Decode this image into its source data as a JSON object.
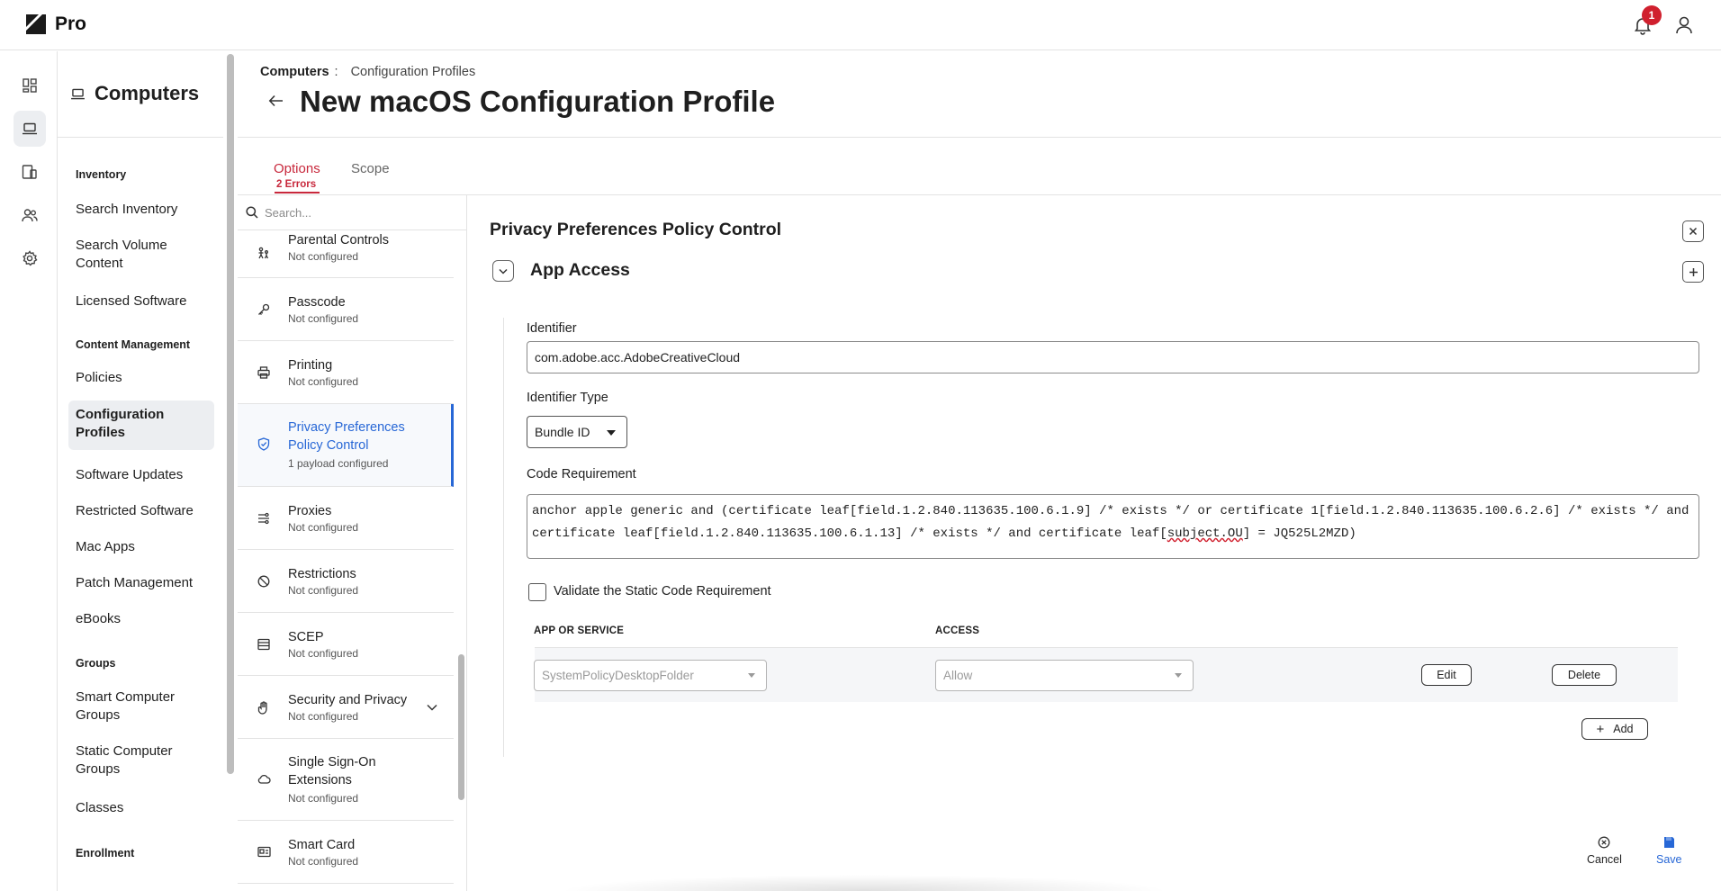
{
  "app": {
    "name": "Pro",
    "notification_count": "1"
  },
  "rail": {
    "items": [
      "dashboard-icon",
      "laptop-icon",
      "devices-icon",
      "users-icon",
      "gear-icon"
    ],
    "active": "laptop-icon"
  },
  "nav": {
    "title": "Computers",
    "sections": [
      {
        "heading": "Inventory",
        "items": [
          "Search Inventory",
          "Search Volume Content",
          "Licensed Software"
        ]
      },
      {
        "heading": "Content Management",
        "items": [
          "Policies",
          "Configuration Profiles",
          "Software Updates",
          "Restricted Software",
          "Mac Apps",
          "Patch Management",
          "eBooks"
        ]
      },
      {
        "heading": "Groups",
        "items": [
          "Smart Computer Groups",
          "Static Computer Groups",
          "Classes"
        ]
      },
      {
        "heading": "Enrollment",
        "items": []
      }
    ],
    "active_item": "Configuration Profiles"
  },
  "breadcrumb": {
    "root": "Computers",
    "separator": ":",
    "current": "Configuration Profiles"
  },
  "page": {
    "title": "New macOS Configuration Profile"
  },
  "tabs": {
    "options": "Options",
    "options_errors": "2 Errors",
    "scope": "Scope"
  },
  "payloads": {
    "search_placeholder": "Search...",
    "items": [
      {
        "name": "Parental Controls",
        "status": "Not configured"
      },
      {
        "name": "Passcode",
        "status": "Not configured"
      },
      {
        "name": "Printing",
        "status": "Not configured"
      },
      {
        "name": "Privacy Preferences Policy Control",
        "status": "1 payload configured"
      },
      {
        "name": "Proxies",
        "status": "Not configured"
      },
      {
        "name": "Restrictions",
        "status": "Not configured"
      },
      {
        "name": "SCEP",
        "status": "Not configured"
      },
      {
        "name": "Security and Privacy",
        "status": "Not configured"
      },
      {
        "name": "Single Sign-On Extensions",
        "status": "Not configured"
      },
      {
        "name": "Smart Card",
        "status": "Not configured"
      }
    ]
  },
  "detail": {
    "title": "Privacy Preferences Policy Control",
    "section": "App Access",
    "identifier_label": "Identifier",
    "identifier_value": "com.adobe.acc.AdobeCreativeCloud",
    "identifier_type_label": "Identifier Type",
    "identifier_type_value": "Bundle ID",
    "code_label": "Code Requirement",
    "code_before": "anchor apple generic and (certificate leaf[field.1.2.840.113635.100.6.1.9] /* exists */ or certificate 1[field.1.2.840.113635.100.6.2.6] /* exists */ and certificate leaf[field.1.2.840.113635.100.6.1.13] /* exists */ and certificate leaf[",
    "code_misspelled": "subject.OU",
    "code_after": "] = JQ525L2MZD)",
    "validate_label": "Validate the Static Code Requirement",
    "validate_checked": false,
    "table": {
      "col_service": "APP OR SERVICE",
      "col_access": "ACCESS",
      "row": {
        "service": "SystemPolicyDesktopFolder",
        "access": "Allow",
        "edit": "Edit",
        "delete": "Delete"
      }
    },
    "add_label": "Add"
  },
  "footer": {
    "cancel": "Cancel",
    "save": "Save"
  },
  "colors": {
    "accent_red": "#c8283c",
    "accent_blue": "#2767d6",
    "badge_red": "#d0202e"
  }
}
